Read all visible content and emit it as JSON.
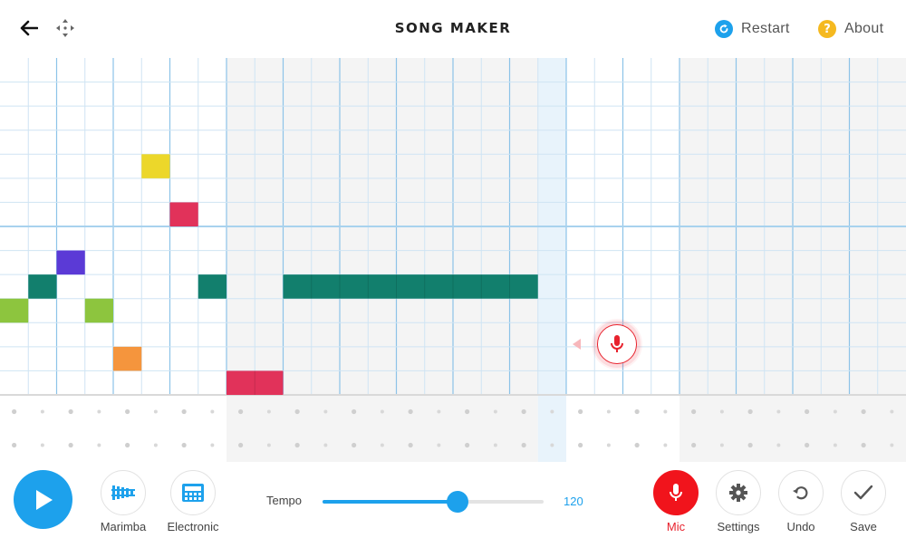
{
  "header": {
    "title": "SONG MAKER",
    "restart_label": "Restart",
    "about_label": "About"
  },
  "colors": {
    "accent": "#1da1ec",
    "mic_red": "#f1141c",
    "note_yellow": "#ecd72a",
    "note_red": "#e1325a",
    "note_purple": "#5b3ad6",
    "note_teal": "#127f6d",
    "note_lime": "#8dc53e",
    "note_orange": "#f5953d"
  },
  "grid": {
    "columns": 32,
    "melody_rows": 14,
    "rhythm_rows": 2,
    "shaded_column_ranges": [
      [
        8,
        19
      ],
      [
        24,
        32
      ]
    ],
    "playhead_column": 19,
    "notes": [
      {
        "col": 0,
        "row": 10,
        "length": 1,
        "color": "#8dc53e"
      },
      {
        "col": 1,
        "row": 9,
        "length": 1,
        "color": "#127f6d"
      },
      {
        "col": 2,
        "row": 8,
        "length": 1,
        "color": "#5b3ad6"
      },
      {
        "col": 3,
        "row": 10,
        "length": 1,
        "color": "#8dc53e"
      },
      {
        "col": 4,
        "row": 12,
        "length": 1,
        "color": "#f5953d"
      },
      {
        "col": 5,
        "row": 4,
        "length": 1,
        "color": "#ecd72a"
      },
      {
        "col": 6,
        "row": 6,
        "length": 1,
        "color": "#e1325a"
      },
      {
        "col": 7,
        "row": 9,
        "length": 1,
        "color": "#127f6d"
      },
      {
        "col": 8,
        "row": 13,
        "length": 2,
        "color": "#e1325a"
      },
      {
        "col": 10,
        "row": 9,
        "length": 9,
        "color": "#127f6d"
      }
    ]
  },
  "toolbar": {
    "play_icon": "play-icon",
    "instruments": [
      {
        "label": "Marimba",
        "icon": "marimba-icon"
      },
      {
        "label": "Electronic",
        "icon": "electronic-icon"
      }
    ],
    "tempo_label": "Tempo",
    "tempo_value": "120",
    "tempo_fraction": 0.61,
    "mic_label": "Mic",
    "settings_label": "Settings",
    "undo_label": "Undo",
    "save_label": "Save"
  }
}
